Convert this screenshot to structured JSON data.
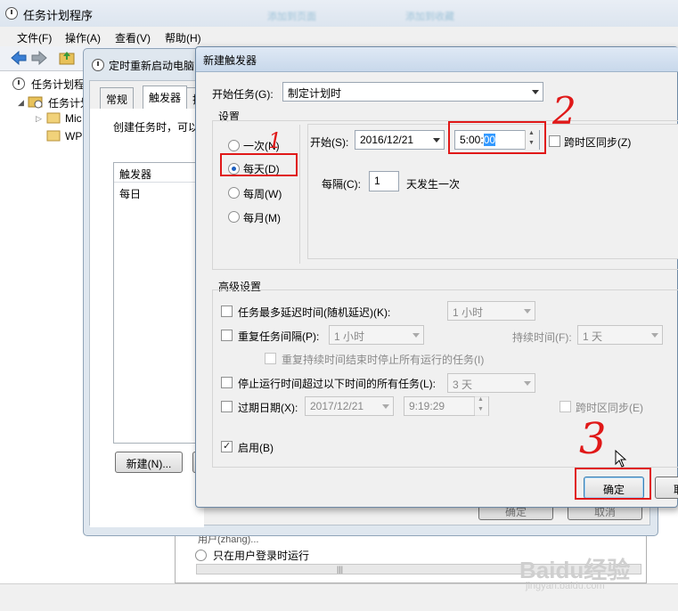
{
  "main_window": {
    "title": "任务计划程序",
    "menu": [
      "文件(F)",
      "操作(A)",
      "查看(V)",
      "帮助(H)"
    ],
    "tree": {
      "root": "任务计划程",
      "library": "任务计划",
      "items": [
        "Mic",
        "WP"
      ]
    },
    "blurred_top_links": [
      "添加到页面",
      "添加到收藏"
    ]
  },
  "background_dialog": {
    "title": "定时重新启动电脑",
    "tabs": [
      "常规",
      "触发器",
      "操"
    ],
    "description": "创建任务时，可以",
    "trigger_list_header": "触发器",
    "trigger_list_rows": [
      "每日"
    ],
    "new_button": "新建(N)...",
    "ok_button": "确定",
    "cancel_button": "取消",
    "lower_text": "只在用户登录时运行",
    "lower_label": "用户(zhang)..."
  },
  "trigger_dialog": {
    "title": "新建触发器",
    "begin_task_label": "开始任务(G):",
    "begin_task_value": "制定计划时",
    "settings_label": "设置",
    "schedule_options": [
      "一次(N)",
      "每天(D)",
      "每周(W)",
      "每月(M)"
    ],
    "selected_schedule": "每天(D)",
    "start_label": "开始(S):",
    "start_date": "2016/12/21",
    "start_time_prefix": "5:00:",
    "start_time_selected": "00",
    "sync_tz_label": "跨时区同步(Z)",
    "recur_label": "每隔(C):",
    "recur_value": "1",
    "recur_unit": "天发生一次",
    "advanced_label": "高级设置",
    "delay_label": "任务最多延迟时间(随机延迟)(K):",
    "delay_value": "1 小时",
    "repeat_label": "重复任务间隔(P):",
    "repeat_value": "1 小时",
    "duration_label": "持续时间(F):",
    "duration_value": "1 天",
    "stop_all_label": "重复持续时间结束时停止所有运行的任务(I)",
    "stop_long_label": "停止运行时间超过以下时间的所有任务(L):",
    "stop_long_value": "3 天",
    "expire_label": "过期日期(X):",
    "expire_date": "2017/12/21",
    "expire_time": "9:19:29",
    "expire_sync_label": "跨时区同步(E)",
    "enabled_label": "启用(B)",
    "ok_button": "确定",
    "cancel_button": "取"
  },
  "annotations": {
    "step1": "1",
    "step2": "2",
    "step3": "3",
    "color": "#e01818"
  },
  "watermark": {
    "brand": "Baidu经验",
    "url": "jingyan.baidu.com"
  }
}
